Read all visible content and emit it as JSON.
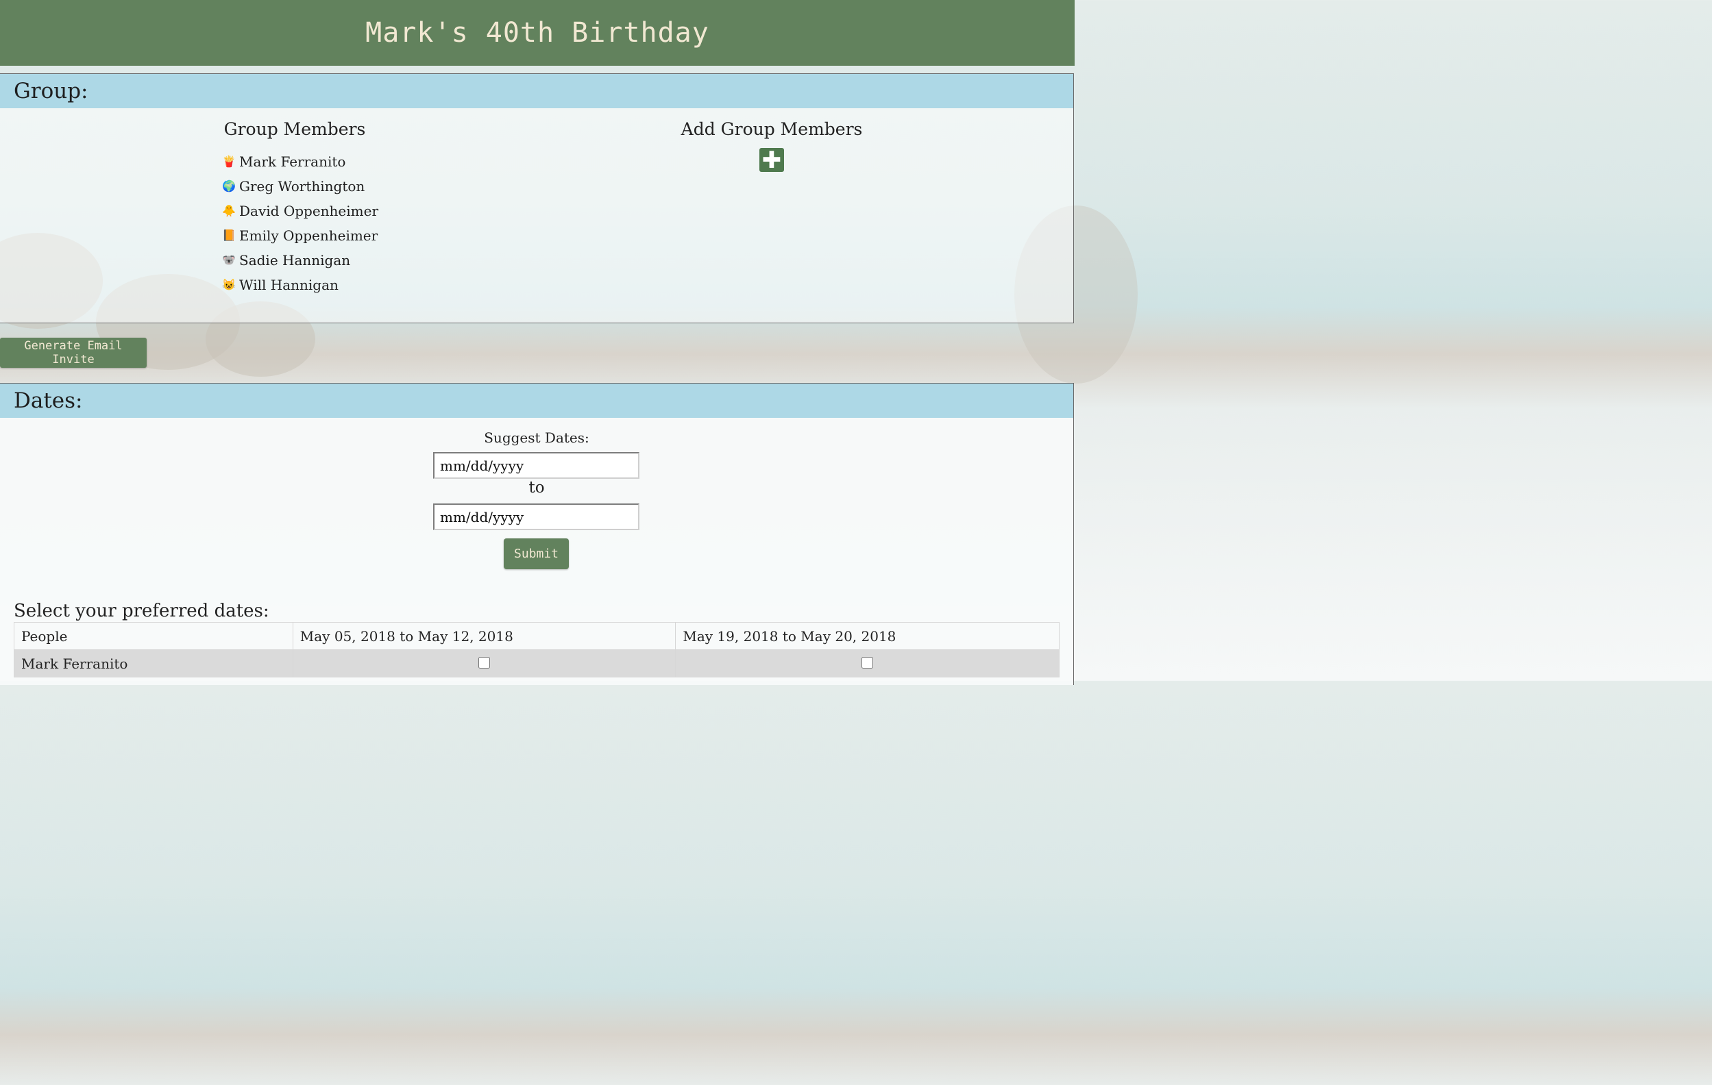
{
  "header": {
    "title": "Mark's 40th Birthday"
  },
  "group": {
    "section_title": "Group:",
    "members_title": "Group Members",
    "add_title": "Add Group Members",
    "members": [
      {
        "emoji": "🍟",
        "name": "Mark Ferranito"
      },
      {
        "emoji": "🌍",
        "name": "Greg Worthington"
      },
      {
        "emoji": "🐥",
        "name": "David Oppenheimer"
      },
      {
        "emoji": "📙",
        "name": "Emily Oppenheimer"
      },
      {
        "emoji": "🐨",
        "name": "Sadie Hannigan"
      },
      {
        "emoji": "😺",
        "name": "Will Hannigan"
      }
    ]
  },
  "email_button": "Generate Email Invite",
  "dates": {
    "section_title": "Dates:",
    "suggest_label": "Suggest Dates:",
    "start_placeholder": "mm/dd/yyyy",
    "to_label": "to",
    "end_placeholder": "mm/dd/yyyy",
    "submit_label": "Submit",
    "select_label": "Select your preferred dates:",
    "table": {
      "headers": [
        "People",
        "May 05, 2018 to May 12, 2018",
        "May 19, 2018 to May 20, 2018"
      ],
      "rows": [
        {
          "name": "Mark Ferranito",
          "checks": [
            false,
            false
          ]
        }
      ]
    }
  },
  "colors": {
    "header": "#62825d",
    "section_header": "#add8e6",
    "button": "#62825d"
  }
}
